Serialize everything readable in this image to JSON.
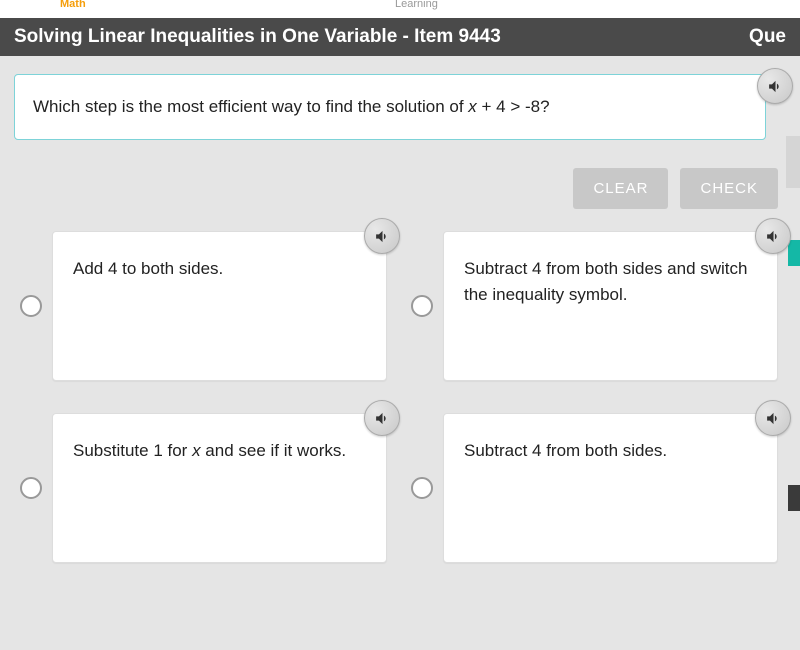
{
  "logo": "Math",
  "learning": "Learning",
  "header": {
    "title": "Solving Linear Inequalities in One Variable - Item 9443",
    "right": "Que"
  },
  "question": {
    "prefix": "Which step is the most efficient way to find the solution of ",
    "var": "x",
    "suffix": " + 4 > -8?"
  },
  "buttons": {
    "clear": "CLEAR",
    "check": "CHECK"
  },
  "options": {
    "a": "Add 4 to both sides.",
    "b": "Subtract 4 from both sides and switch the inequality symbol.",
    "c_prefix": "Substitute 1 for ",
    "c_var": "x",
    "c_suffix": " and see if it works.",
    "d": "Subtract 4 from both sides."
  }
}
